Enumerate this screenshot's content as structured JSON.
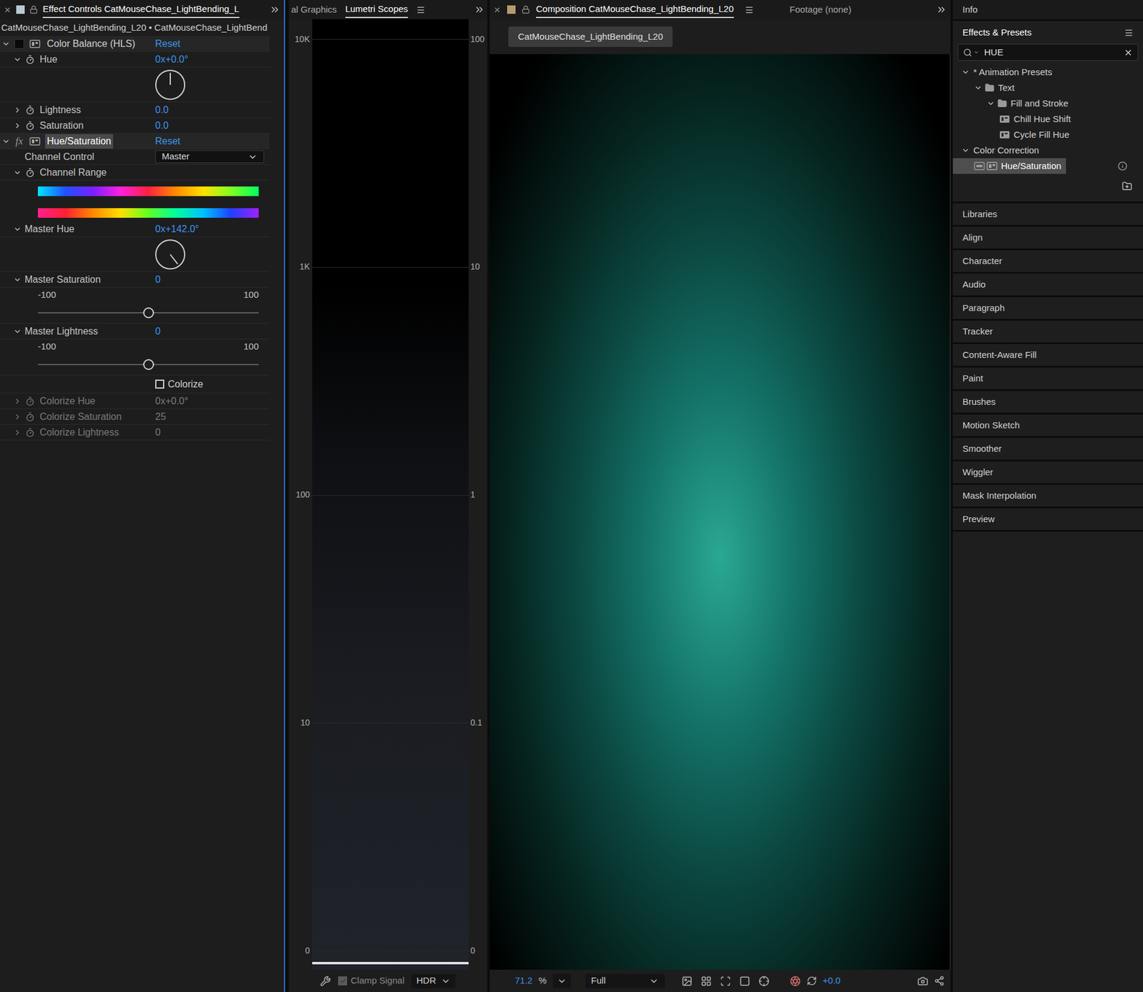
{
  "effectControls": {
    "tabTitle": "Effect Controls CatMouseChase_LightBending_L",
    "breadcrumb": "CatMouseChase_LightBending_L20 • CatMouseChase_LightBend",
    "fxLabel": "fx",
    "effects": [
      {
        "name": "Color Balance (HLS)",
        "reset": "Reset",
        "expanded": true,
        "enabled": false,
        "selected": false,
        "properties": [
          {
            "kind": "dial",
            "label": "Hue",
            "value": "0x+0.0°",
            "angle": 0,
            "expanded": true,
            "stopwatch": true,
            "disabled": false
          },
          {
            "kind": "value",
            "label": "Lightness",
            "value": "0.0",
            "expanded": false,
            "stopwatch": true,
            "disabled": false
          },
          {
            "kind": "value",
            "label": "Saturation",
            "value": "0.0",
            "expanded": false,
            "stopwatch": true,
            "disabled": false
          }
        ]
      },
      {
        "name": "Hue/Saturation",
        "reset": "Reset",
        "expanded": true,
        "enabled": true,
        "selected": true,
        "properties": [
          {
            "kind": "dropdown",
            "label": "Channel Control",
            "value": "Master"
          },
          {
            "kind": "range",
            "label": "Channel Range",
            "expanded": true,
            "stopwatch": true,
            "disabled": false
          },
          {
            "kind": "dial",
            "label": "Master Hue",
            "value": "0x+142.0°",
            "angle": 142,
            "expanded": true,
            "stopwatch": false,
            "disabled": false
          },
          {
            "kind": "slider",
            "label": "Master Saturation",
            "value": "0",
            "min": "-100",
            "max": "100",
            "level": 0.5,
            "expanded": true,
            "stopwatch": false,
            "disabled": false
          },
          {
            "kind": "slider",
            "label": "Master Lightness",
            "value": "0",
            "min": "-100",
            "max": "100",
            "level": 0.5,
            "expanded": true,
            "stopwatch": false,
            "disabled": false
          },
          {
            "kind": "checkbox",
            "label": "Colorize",
            "checked": false
          },
          {
            "kind": "value",
            "label": "Colorize Hue",
            "value": "0x+0.0°",
            "expanded": false,
            "stopwatch": true,
            "disabled": true
          },
          {
            "kind": "value",
            "label": "Colorize Saturation",
            "value": "25",
            "expanded": false,
            "stopwatch": true,
            "disabled": true
          },
          {
            "kind": "value",
            "label": "Colorize Lightness",
            "value": "0",
            "expanded": false,
            "stopwatch": true,
            "disabled": true
          }
        ]
      }
    ]
  },
  "scopes": {
    "tabs": [
      {
        "label": "al Graphics",
        "selected": false
      },
      {
        "label": "Lumetri Scopes",
        "selected": true
      }
    ],
    "leftTicks": [
      "10K",
      "1K",
      "100",
      "10",
      "0"
    ],
    "rightTicks": [
      "100",
      "10",
      "1",
      "0.1",
      "0"
    ],
    "clampSignal": {
      "label": "Clamp Signal",
      "checked": true
    },
    "range": "HDR"
  },
  "composition": {
    "tabTitle": "Composition CatMouseChase_LightBending_L20",
    "footageTab": "Footage (none)",
    "viewerTab": "CatMouseChase_LightBending_L20",
    "zoom": "71.2",
    "percent": "%",
    "resolution": "Full",
    "exposure": "+0.0"
  },
  "rightPanel": {
    "infoTab": "Info",
    "effectsTitle": "Effects & Presets",
    "search": "HUE",
    "tree": [
      {
        "label": "* Animation Presets",
        "depth": 0,
        "kind": "category",
        "expanded": true,
        "selected": false
      },
      {
        "label": "Text",
        "depth": 1,
        "kind": "folder",
        "expanded": true,
        "selected": false
      },
      {
        "label": "Fill and Stroke",
        "depth": 2,
        "kind": "folder",
        "expanded": true,
        "selected": false
      },
      {
        "label": "Chill Hue Shift",
        "depth": 3,
        "kind": "preset",
        "expanded": false,
        "selected": false
      },
      {
        "label": "Cycle Fill Hue",
        "depth": 3,
        "kind": "preset",
        "expanded": false,
        "selected": false
      },
      {
        "label": "Color Correction",
        "depth": 0,
        "kind": "category",
        "expanded": true,
        "selected": false
      },
      {
        "label": "Hue/Saturation",
        "depth": 1,
        "kind": "effect",
        "expanded": false,
        "selected": true
      }
    ],
    "panels": [
      "Libraries",
      "Align",
      "Character",
      "Audio",
      "Paragraph",
      "Tracker",
      "Content-Aware Fill",
      "Paint",
      "Brushes",
      "Motion Sketch",
      "Smoother",
      "Wiggler",
      "Mask Interpolation",
      "Preview"
    ]
  }
}
